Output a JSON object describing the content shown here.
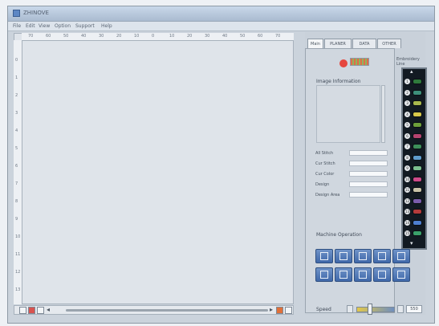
{
  "window": {
    "title": "ZHINOVE"
  },
  "menu": [
    "File",
    "Edit",
    "View",
    "Option",
    "Support",
    "Help"
  ],
  "ruler": {
    "h_ticks": [
      "70",
      "60",
      "50",
      "40",
      "30",
      "20",
      "10",
      "0",
      "10",
      "20",
      "30",
      "40",
      "50",
      "60",
      "70"
    ],
    "v_ticks": [
      "0",
      "1",
      "2",
      "3",
      "4",
      "5",
      "6",
      "7",
      "8",
      "9",
      "10",
      "11",
      "12",
      "13"
    ]
  },
  "panel": {
    "tabs": [
      "Main",
      "PLANER",
      "DATA",
      "OTHER"
    ],
    "image_information_label": "Image Information",
    "fields": [
      {
        "label": "All Stitch"
      },
      {
        "label": "Cur Stitch"
      },
      {
        "label": "Cur Color"
      },
      {
        "label": "Design"
      },
      {
        "label": "Design Area"
      }
    ],
    "needle_label": "Embroidery Line",
    "needles": [
      {
        "num": "1",
        "color": "#2f7a3c"
      },
      {
        "num": "2",
        "color": "#3d8f7a"
      },
      {
        "num": "3",
        "color": "#a8b84d"
      },
      {
        "num": "4",
        "color": "#d8c94a"
      },
      {
        "num": "5",
        "color": "#6d9f3a"
      },
      {
        "num": "6",
        "color": "#b4436f"
      },
      {
        "num": "7",
        "color": "#3d8f5a"
      },
      {
        "num": "8",
        "color": "#5f9ccc"
      },
      {
        "num": "9",
        "color": "#7bbf8f"
      },
      {
        "num": "10",
        "color": "#cf4a8a"
      },
      {
        "num": "11",
        "color": "#c9c3a8"
      },
      {
        "num": "12",
        "color": "#7a5cab"
      },
      {
        "num": "13",
        "color": "#b43b3b"
      },
      {
        "num": "14",
        "color": "#4e7fd0"
      },
      {
        "num": "15",
        "color": "#3aa06a"
      }
    ],
    "machine_operation_label": "Machine Operation",
    "machine_buttons": [
      "mc-btn-1",
      "mc-btn-2",
      "mc-btn-3",
      "mc-btn-4",
      "mc-btn-5",
      "mc-btn-6",
      "mc-btn-7",
      "mc-btn-8",
      "mc-btn-9",
      "mc-btn-10"
    ],
    "speed_label": "Speed",
    "speed_value": "550"
  },
  "colors": {
    "indicator": "#e5473f",
    "machine_button": "#4f76b6"
  }
}
